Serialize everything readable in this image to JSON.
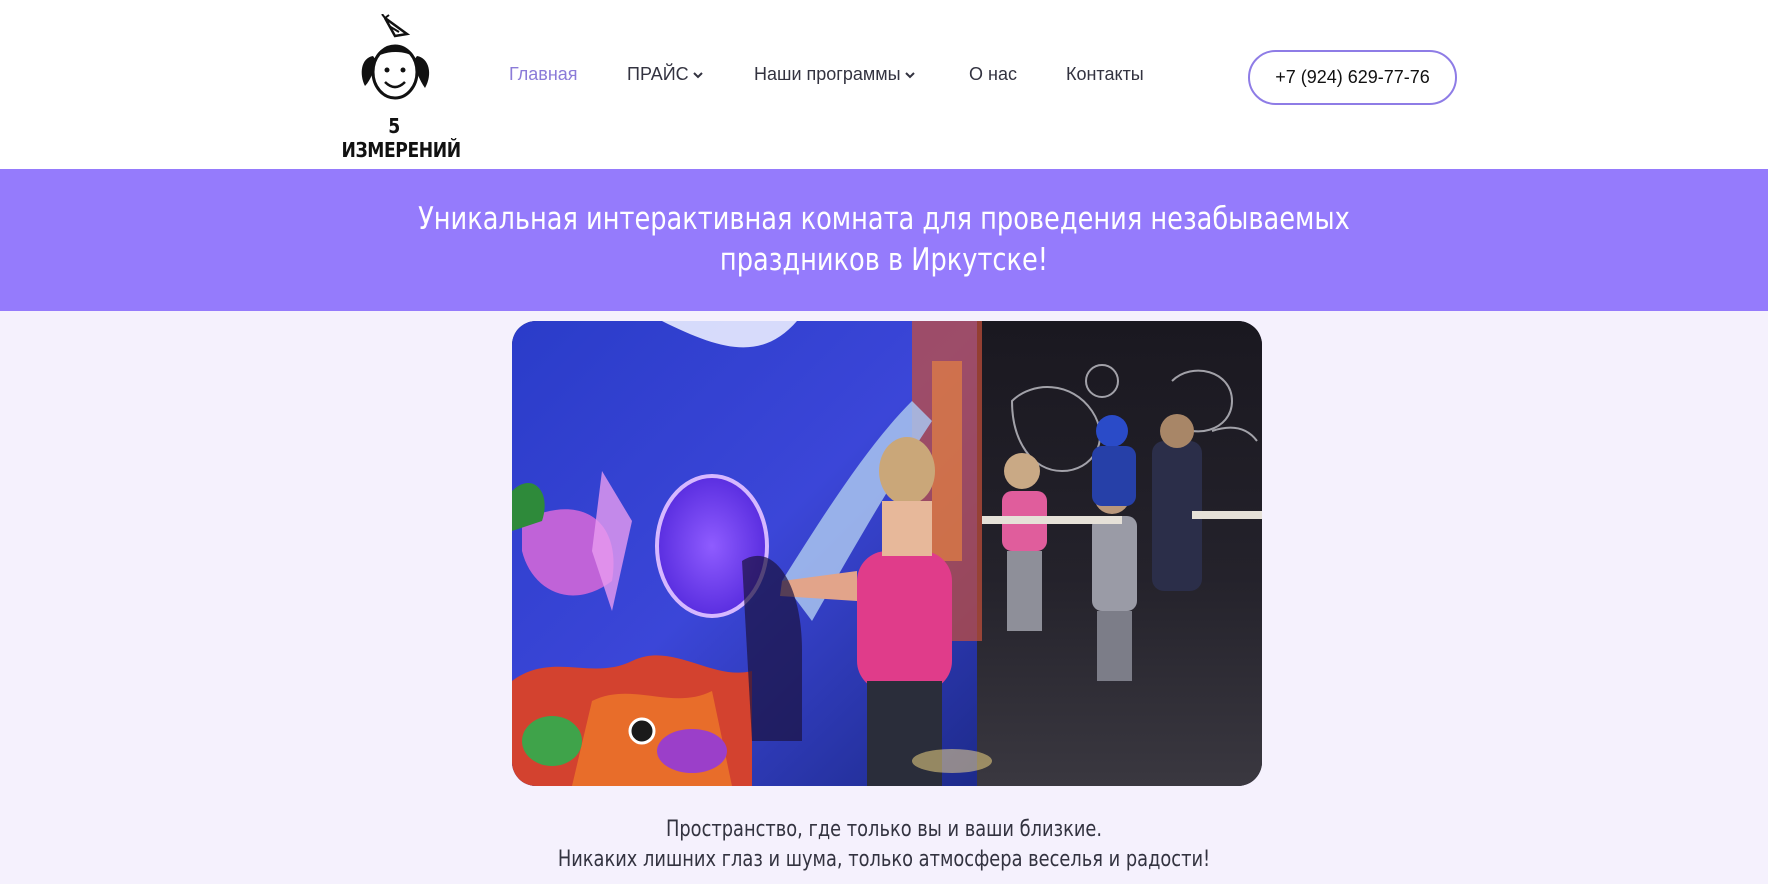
{
  "header": {
    "logo": {
      "text": "5 ИЗМЕРЕНИЙ",
      "icon": "girl-with-party-hat-icon"
    },
    "nav": [
      {
        "label": "Главная",
        "active": true,
        "has_dropdown": false
      },
      {
        "label": "ПРАЙС",
        "active": false,
        "has_dropdown": true
      },
      {
        "label": "Наши программы",
        "active": false,
        "has_dropdown": true
      },
      {
        "label": "О нас",
        "active": false,
        "has_dropdown": false
      },
      {
        "label": "Контакты",
        "active": false,
        "has_dropdown": false
      }
    ],
    "phone": "+7 (924) 629-77-76"
  },
  "banner": {
    "title": "Уникальная интерактивная комната для проведения незабываемых праздников в Иркутске!"
  },
  "hero": {
    "icon": "kids-interactive-projection-room-photo"
  },
  "description": {
    "line1": "Пространство, где только вы и ваши близкие.",
    "line2": "Никаких лишних глаз и шума, только атмосфера веселья и радости!"
  },
  "colors": {
    "accent": "#957bfc",
    "nav_active": "#8b7bd8",
    "button_border": "#8e7ce6",
    "page_bg": "#f5f1fd"
  }
}
